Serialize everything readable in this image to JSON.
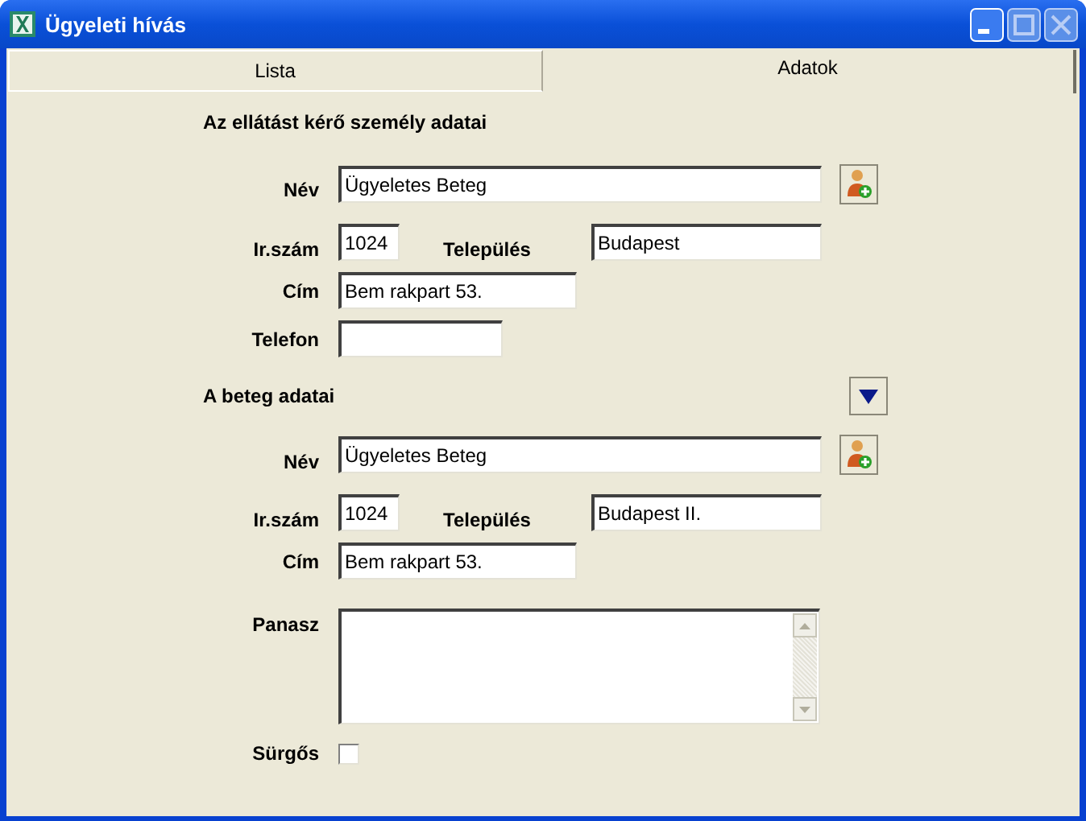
{
  "window": {
    "title": "Ügyeleti hívás"
  },
  "tabs": [
    {
      "label": "Lista",
      "selected": false
    },
    {
      "label": "Adatok",
      "selected": true
    }
  ],
  "rows": [
    {
      "kind": "heading",
      "text": "Az ellátást kérő személy adatai"
    },
    {
      "kind": "name",
      "label": "Név",
      "value": "Ügyeletes Beteg"
    },
    {
      "kind": "address",
      "zip_label": "Ir.szám",
      "zip": "1024",
      "city_label": "Település",
      "city": "Budapest"
    },
    {
      "kind": "text",
      "label": "Cím",
      "value": "Bem rakpart 53."
    },
    {
      "kind": "phone",
      "label": "Telefon"
    },
    {
      "kind": "toggle_heading",
      "text": "A beteg adatai"
    },
    {
      "kind": "name",
      "label": "Név",
      "value": "Ügyeletes Beteg"
    },
    {
      "kind": "address",
      "zip_label": "Ir.szám",
      "zip": "1024",
      "city_label": "Település",
      "city": "Budapest II."
    },
    {
      "kind": "text",
      "label": "Cím",
      "value": "Bem rakpart 53."
    },
    {
      "kind": "textarea",
      "label": "Panasz"
    },
    {
      "kind": "checkbox",
      "label": "Sürgős",
      "checked": false
    }
  ]
}
